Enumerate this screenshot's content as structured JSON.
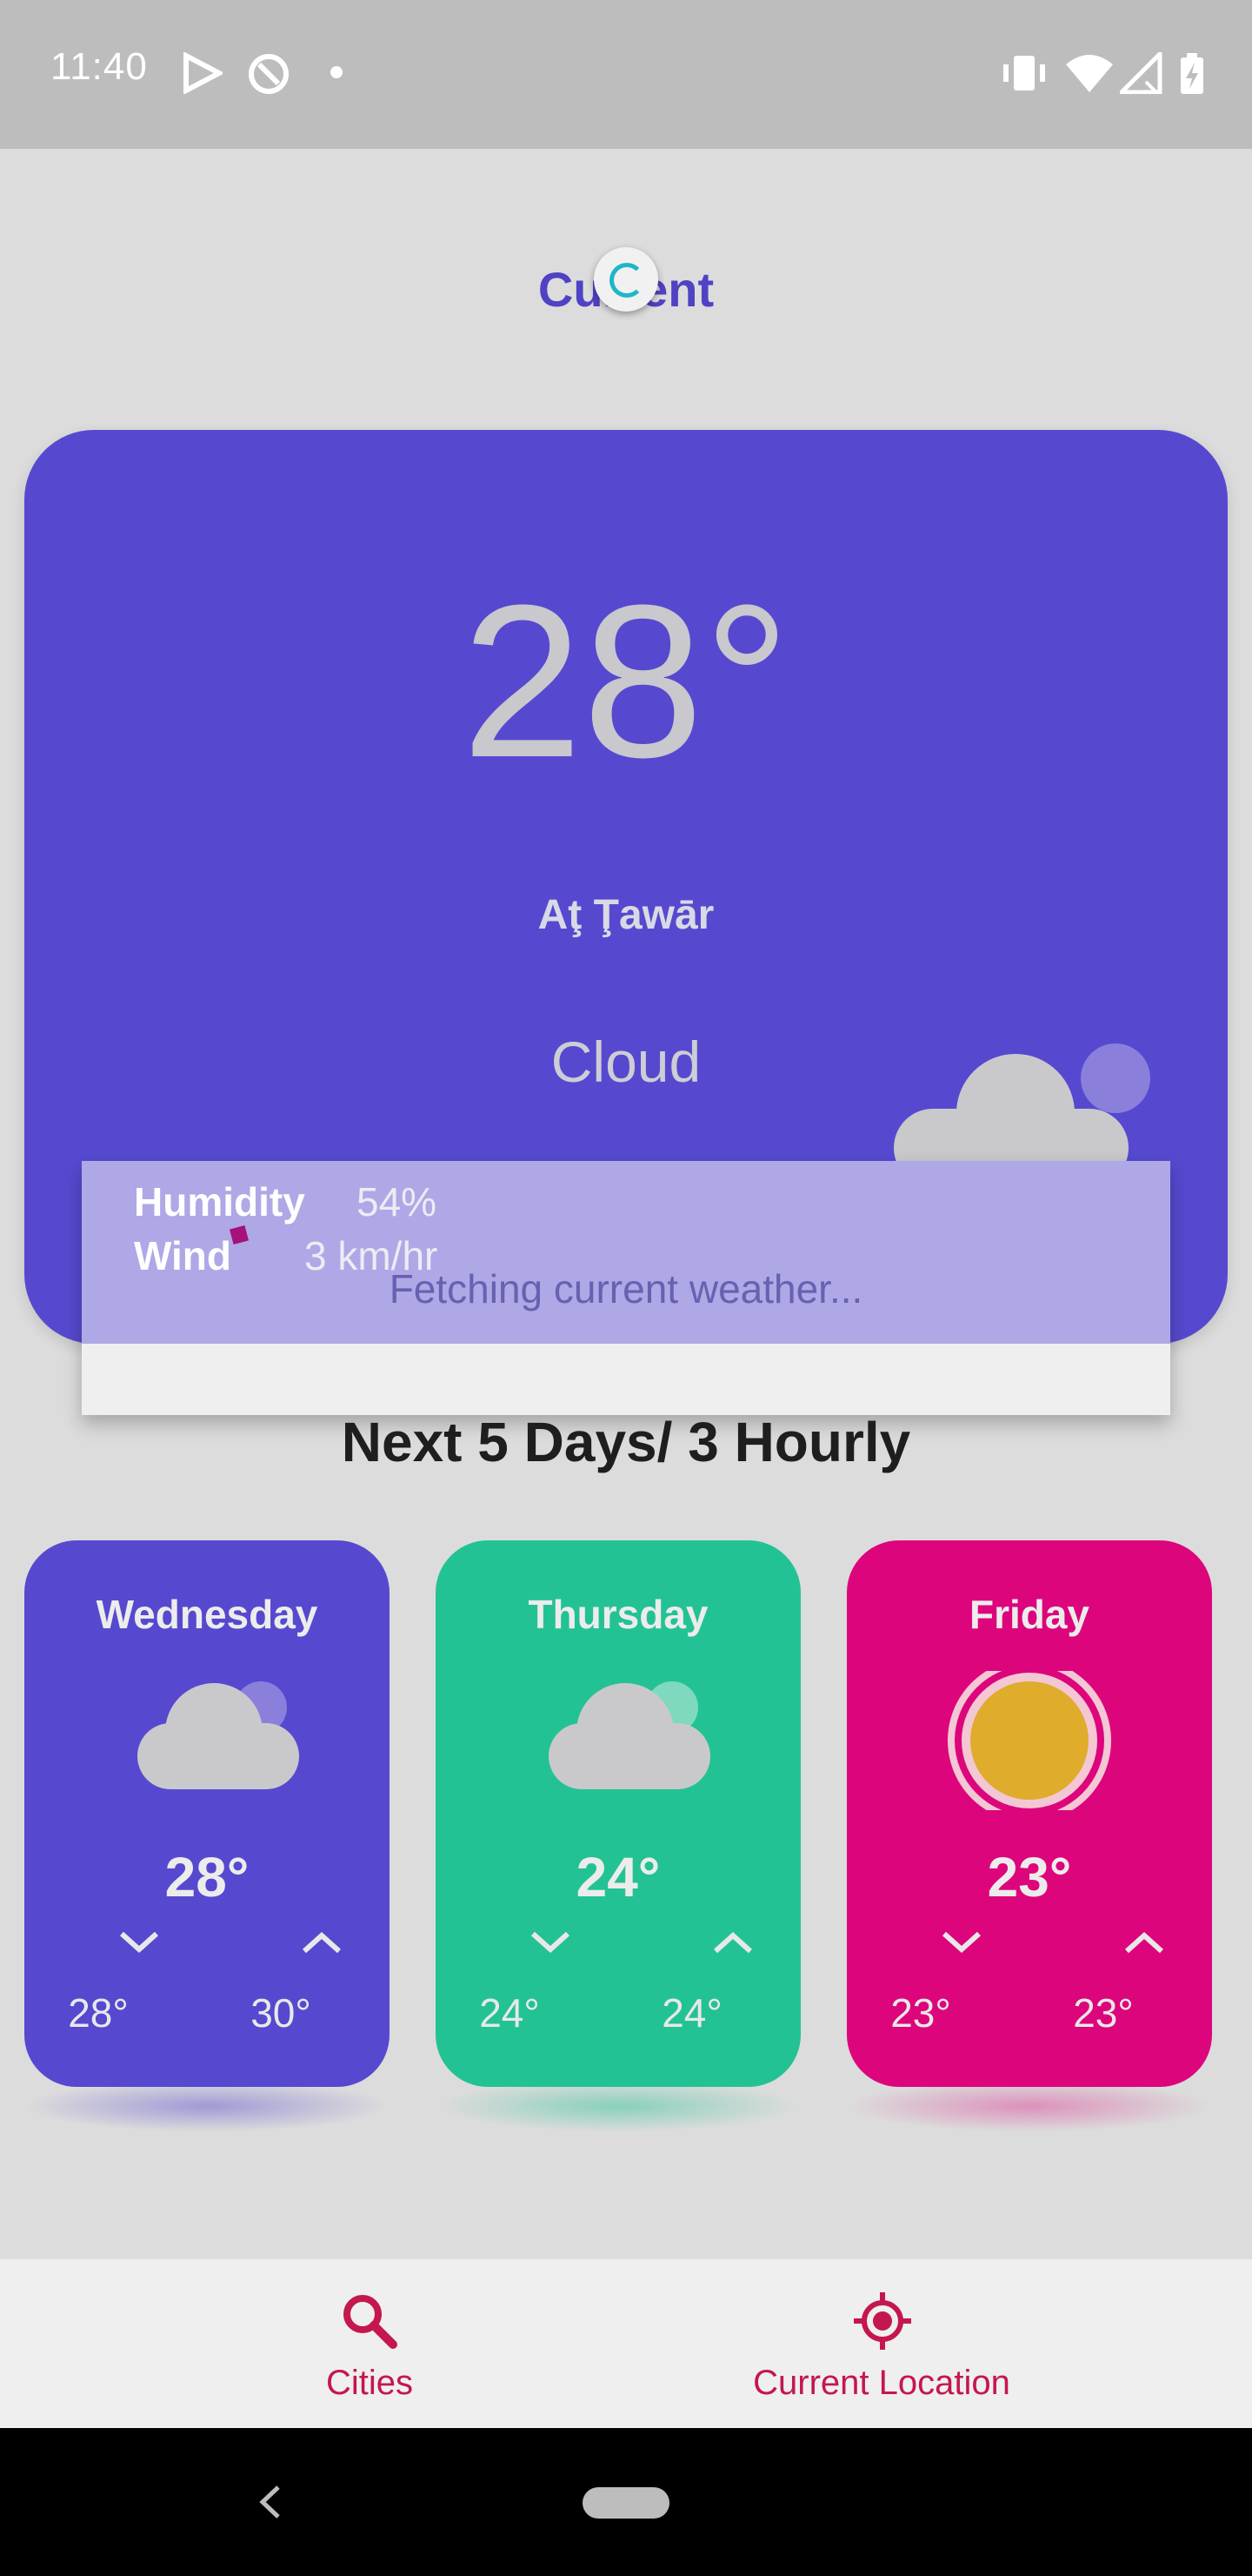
{
  "status_bar": {
    "time": "11:40"
  },
  "header": {
    "title": "Current"
  },
  "current": {
    "temperature": "28°",
    "city": "Aţ Ţawār",
    "condition": "Cloud",
    "humidity_label": "Humidity",
    "humidity_value": "54%",
    "wind_label": "Wind",
    "wind_value": "3 km/hr"
  },
  "dialog": {
    "message": "Fetching current weather..."
  },
  "forecast": {
    "heading": "Next 5 Days/ 3 Hourly",
    "days": [
      {
        "name": "Wednesday",
        "temp": "28°",
        "min": "28°",
        "max": "30°",
        "icon": "cloud-icon",
        "color": "#5649cf"
      },
      {
        "name": "Thursday",
        "temp": "24°",
        "min": "24°",
        "max": "24°",
        "icon": "cloud-icon",
        "color": "#23c294"
      },
      {
        "name": "Friday",
        "temp": "23°",
        "min": "23°",
        "max": "23°",
        "icon": "sun-icon",
        "color": "#dd057c"
      }
    ]
  },
  "bottom_nav": {
    "cities_label": "Cities",
    "current_location_label": "Current Location"
  },
  "colors": {
    "accent": "#4f42c4",
    "nav_active": "#c4174d",
    "card_primary": "#5649cf",
    "card_green": "#23c294",
    "card_pink": "#dd057c"
  }
}
